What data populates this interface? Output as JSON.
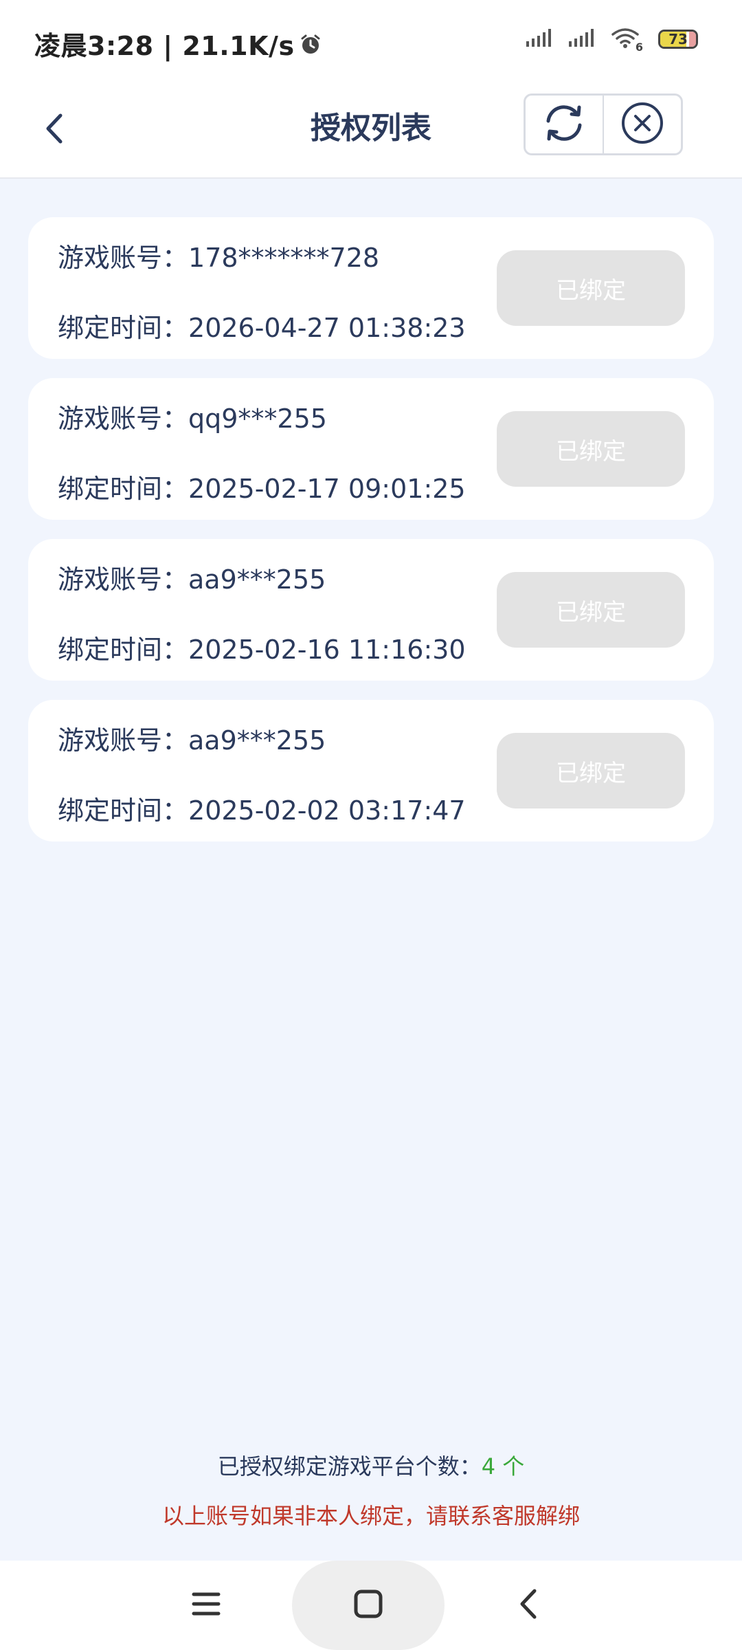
{
  "status_bar": {
    "time_text": "凌晨3:28 | 21.1K/s",
    "wifi_badge": "6",
    "battery_level": "73",
    "battery_percent": 73
  },
  "header": {
    "title": "授权列表"
  },
  "cards": [
    {
      "account_label": "游戏账号：",
      "account_value": "178*******728",
      "time_label": "绑定时间：",
      "time_value": "2026-04-27 01:38:23",
      "button_label": "已绑定"
    },
    {
      "account_label": "游戏账号：",
      "account_value": "qq9***255",
      "time_label": "绑定时间：",
      "time_value": "2025-02-17 09:01:25",
      "button_label": "已绑定"
    },
    {
      "account_label": "游戏账号：",
      "account_value": "aa9***255",
      "time_label": "绑定时间：",
      "time_value": "2025-02-16 11:16:30",
      "button_label": "已绑定"
    },
    {
      "account_label": "游戏账号：",
      "account_value": "aa9***255",
      "time_label": "绑定时间：",
      "time_value": "2025-02-02 03:17:47",
      "button_label": "已绑定"
    }
  ],
  "footer": {
    "count_label": "已授权绑定游戏平台个数：",
    "count_value": "4 个",
    "warning": "以上账号如果非本人绑定，请联系客服解绑"
  },
  "colors": {
    "background": "#f1f5fd",
    "text_primary": "#2b3a5c",
    "count_green": "#3aa83a",
    "warning_red": "#c0392b",
    "button_disabled": "#e3e3e3"
  },
  "icons": {
    "back": "chevron-left-icon",
    "refresh": "refresh-icon",
    "close": "close-circle-icon",
    "nav_menu": "menu-icon",
    "nav_home": "square-icon",
    "nav_back": "chevron-left-icon",
    "alarm": "alarm-icon",
    "signal": "signal-icon",
    "wifi": "wifi-icon",
    "battery": "battery-icon"
  }
}
